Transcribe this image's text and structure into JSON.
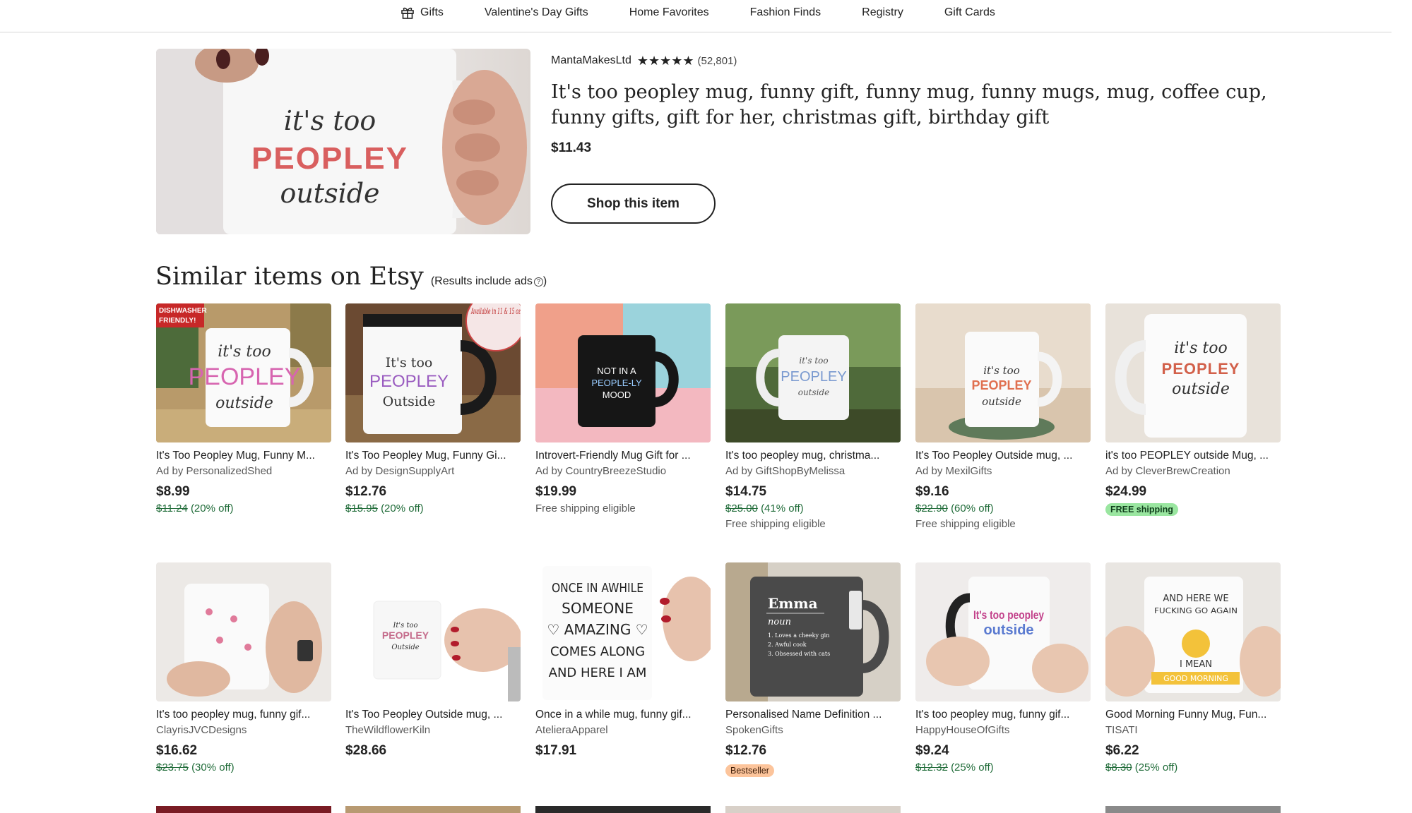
{
  "nav": {
    "items": [
      {
        "label": "Gifts",
        "icon": "gift-icon"
      },
      {
        "label": "Valentine's Day Gifts"
      },
      {
        "label": "Home Favorites"
      },
      {
        "label": "Fashion Finds"
      },
      {
        "label": "Registry"
      },
      {
        "label": "Gift Cards"
      }
    ]
  },
  "hero": {
    "image_text": {
      "line1": "it's too",
      "line2": "PEOPLEY",
      "line3": "outside"
    },
    "shop_name": "MantaMakesLtd",
    "stars": "★★★★★",
    "rating": 5,
    "review_count": "(52,801)",
    "title": "It's too peopley mug, funny gift, funny mug, funny mugs, mug, coffee cup, funny gifts, gift for her, christmas gift, birthday gift",
    "price": "$11.43",
    "shop_button": "Shop this item"
  },
  "similar": {
    "title": "Similar items on Etsy",
    "note": "(Results include ads",
    "info_icon": "info-icon",
    "items": [
      {
        "title": "It's Too Peopley Mug, Funny M...",
        "shop": "Ad by PersonalizedShed",
        "price": "$8.99",
        "original": "$11.24",
        "discount": "(20% off)",
        "image_text": {
          "tag": "DISHWASHER FRIENDLY!",
          "l1": "it's too",
          "l2": "PEOPLEY",
          "l3": "outside"
        }
      },
      {
        "title": "It's Too Peopley Mug, Funny Gi...",
        "shop": "Ad by DesignSupplyArt",
        "price": "$12.76",
        "original": "$15.95",
        "discount": "(20% off)",
        "image_text": {
          "tag": "Available in 11 & 15 oz",
          "l1": "It's too",
          "l2": "PEOPLEY",
          "l3": "Outside"
        }
      },
      {
        "title": "Introvert-Friendly Mug Gift for ...",
        "shop": "Ad by CountryBreezeStudio",
        "price": "$19.99",
        "shipping": "Free shipping eligible",
        "image_text": {
          "l1": "NOT IN A",
          "l2": "PEOPLE-LY",
          "l3": "MOOD"
        }
      },
      {
        "title": "It's too peopley mug, christma...",
        "shop": "Ad by GiftShopByMelissa",
        "price": "$14.75",
        "original": "$25.00",
        "discount": "(41% off)",
        "shipping": "Free shipping eligible",
        "image_text": {
          "l1": "it's too",
          "l2": "PEOPLEY",
          "l3": "outside"
        }
      },
      {
        "title": "It's Too Peopley Outside mug, ...",
        "shop": "Ad by MexilGifts",
        "price": "$9.16",
        "original": "$22.90",
        "discount": "(60% off)",
        "shipping": "Free shipping eligible",
        "image_text": {
          "l1": "it's too",
          "l2": "PEOPLEY",
          "l3": "outside"
        }
      },
      {
        "title": "it's too PEOPLEY outside Mug, ...",
        "shop": "Ad by CleverBrewCreation",
        "price": "$24.99",
        "badge": "FREE shipping",
        "image_text": {
          "l1": "it's too",
          "l2": "PEOPLEY",
          "l3": "outside"
        }
      },
      {
        "title": "It's too peopley mug, funny gif...",
        "shop": "ClayrisJVCDesigns",
        "price": "$16.62",
        "original": "$23.75",
        "discount": "(30% off)"
      },
      {
        "title": "It's Too Peopley Outside mug, ...",
        "shop": "TheWildflowerKiln",
        "price": "$28.66",
        "image_text": {
          "l1": "It's too",
          "l2": "PEOPLEY",
          "l3": "Outside"
        }
      },
      {
        "title": "Once in a while mug, funny gif...",
        "shop": "AtelieraApparel",
        "price": "$17.91",
        "image_text": {
          "l1": "ONCE IN AWHILE",
          "l2": "SOMEONE",
          "l3": "♡ AMAZING ♡",
          "l4": "COMES ALONG",
          "l5": "AND HERE I AM"
        }
      },
      {
        "title": "Personalised Name Definition ...",
        "shop": "SpokenGifts",
        "price": "$12.76",
        "badge": "Bestseller",
        "image_text": {
          "l1": "Emma",
          "l2": "noun",
          "l3": "1. Loves a cheeky gin",
          "l4": "2. Awful cook",
          "l5": "3. Obsessed with cats"
        }
      },
      {
        "title": "It's too peopley mug, funny gif...",
        "shop": "HappyHouseOfGifts",
        "price": "$9.24",
        "original": "$12.32",
        "discount": "(25% off)",
        "image_text": {
          "l1": "It's too peopley",
          "l2": "outside"
        }
      },
      {
        "title": "Good Morning Funny Mug, Fun...",
        "shop": "TISATI",
        "price": "$6.22",
        "original": "$8.30",
        "discount": "(25% off)",
        "image_text": {
          "l1": "AND HERE WE",
          "l2": "FUCKING GO AGAIN",
          "l3": "I MEAN",
          "l4": "GOOD MORNING"
        }
      }
    ]
  },
  "colors": {
    "discount_green": "#1f6b38",
    "free_badge": "#9ae6a0",
    "bestseller_badge": "#fcc49b"
  }
}
